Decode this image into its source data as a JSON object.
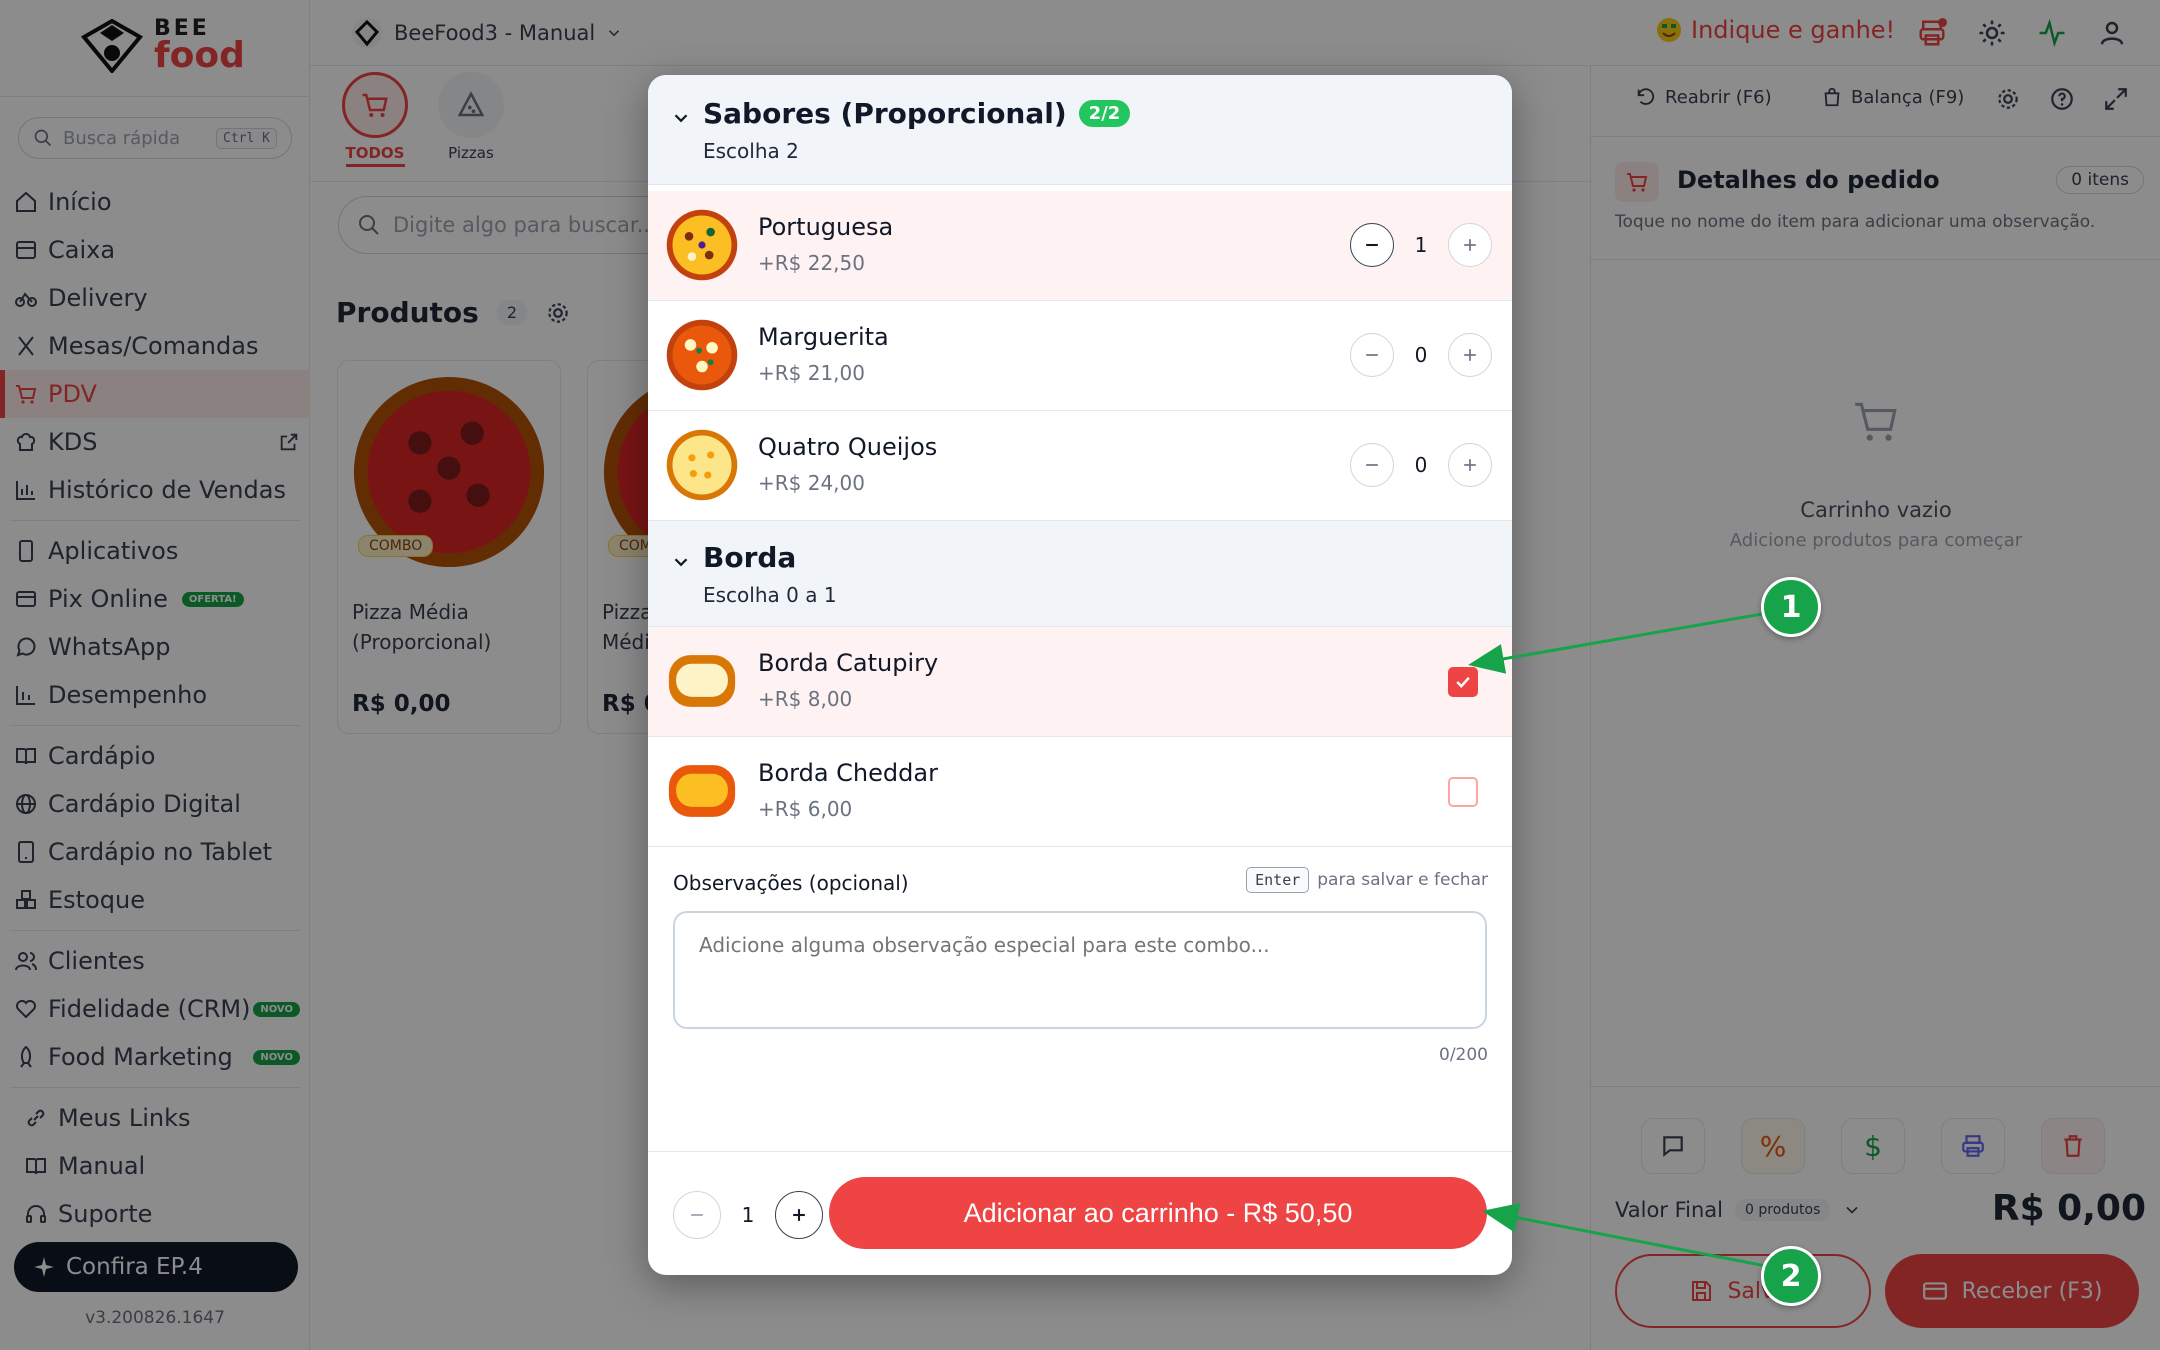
{
  "brand": {
    "bee": "BEE",
    "food": "food"
  },
  "sidebar": {
    "quick_search": {
      "placeholder": "Busca rápida",
      "shortcut": "Ctrl K"
    },
    "nav": [
      {
        "label": "Início",
        "icon": "home-icon"
      },
      {
        "label": "Caixa",
        "icon": "cash-register-icon"
      },
      {
        "label": "Delivery",
        "icon": "bike-icon"
      },
      {
        "label": "Mesas/Comandas",
        "icon": "utensils-icon"
      },
      {
        "label": "PDV",
        "icon": "cart-icon",
        "active": true
      },
      {
        "label": "KDS",
        "icon": "chef-hat-icon"
      },
      {
        "label": "Histórico de Vendas",
        "icon": "bar-chart-icon"
      }
    ],
    "nav2": [
      {
        "label": "Aplicativos",
        "icon": "smartphone-icon"
      },
      {
        "label": "Pix Online",
        "icon": "pix-icon",
        "badge": "OFERTA!"
      },
      {
        "label": "WhatsApp",
        "icon": "chat-icon"
      },
      {
        "label": "Desempenho",
        "icon": "stats-icon"
      }
    ],
    "nav3": [
      {
        "label": "Cardápio",
        "icon": "book-icon"
      },
      {
        "label": "Cardápio Digital",
        "icon": "globe-icon"
      },
      {
        "label": "Cardápio no Tablet",
        "icon": "tablet-icon"
      },
      {
        "label": "Estoque",
        "icon": "boxes-icon"
      }
    ],
    "nav4": [
      {
        "label": "Clientes",
        "icon": "users-icon"
      },
      {
        "label": "Fidelidade (CRM)",
        "icon": "heart-icon",
        "badge": "NOVO"
      },
      {
        "label": "Food Marketing",
        "icon": "rocket-icon",
        "badge": "NOVO"
      }
    ],
    "nav5": [
      {
        "label": "Meus Links",
        "icon": "link-icon"
      },
      {
        "label": "Manual",
        "icon": "book-icon"
      },
      {
        "label": "Suporte",
        "icon": "headset-icon"
      }
    ],
    "cta": "Confira EP.4",
    "version": "v3.200826.1647"
  },
  "topbar": {
    "workspace": "BeeFood3 - Manual",
    "promo": "Indique e ganhe!"
  },
  "categories": [
    {
      "label": "TODOS",
      "active": true
    },
    {
      "label": "Pizzas",
      "active": false
    }
  ],
  "product_search": {
    "placeholder": "Digite algo para buscar..."
  },
  "products": {
    "title": "Produtos",
    "count": "2",
    "items": [
      {
        "name": "Pizza Média (Proporcional)",
        "tag": "COMBO",
        "price": "R$ 0,00"
      },
      {
        "name": "Pizza Grande da Média",
        "tag": "COMBO",
        "price": "R$ 0,00"
      }
    ]
  },
  "right_panel": {
    "reopen": "Reabrir (F6)",
    "scale": "Balança (F9)",
    "title": "Detalhes do pedido",
    "items_count": "0 itens",
    "hint": "Toque no nome do item para adicionar uma observação.",
    "empty_title": "Carrinho vazio",
    "empty_sub": "Adicione produtos para começar",
    "final_label": "Valor Final",
    "products_pill": "0 produtos",
    "total": "R$ 0,00",
    "save": "Salvar",
    "receive": "Receber (F3)"
  },
  "modal": {
    "flavors": {
      "title": "Sabores (Proporcional)",
      "badge": "2/2",
      "subtitle": "Escolha 2",
      "options": [
        {
          "name": "Portuguesa",
          "price": "+R$ 22,50",
          "qty": "1",
          "selected": true
        },
        {
          "name": "Marguerita",
          "price": "+R$ 21,00",
          "qty": "0",
          "selected": false
        },
        {
          "name": "Quatro Queijos",
          "price": "+R$ 24,00",
          "qty": "0",
          "selected": false
        }
      ]
    },
    "crust": {
      "title": "Borda",
      "subtitle": "Escolha 0 a 1",
      "options": [
        {
          "name": "Borda Catupiry",
          "price": "+R$ 8,00",
          "checked": true
        },
        {
          "name": "Borda Cheddar",
          "price": "+R$ 6,00",
          "checked": false
        }
      ]
    },
    "notes": {
      "label": "Observações (opcional)",
      "key": "Enter",
      "hint": "para salvar e fechar",
      "placeholder": "Adicione alguma observação especial para este combo...",
      "counter": "0/200"
    },
    "quantity": "1",
    "add_button": "Adicionar ao carrinho - R$ 50,50"
  },
  "annotations": [
    "1",
    "2"
  ],
  "colors": {
    "accent": "#ef4444",
    "success": "#22c55e",
    "callout": "#16a34a"
  }
}
